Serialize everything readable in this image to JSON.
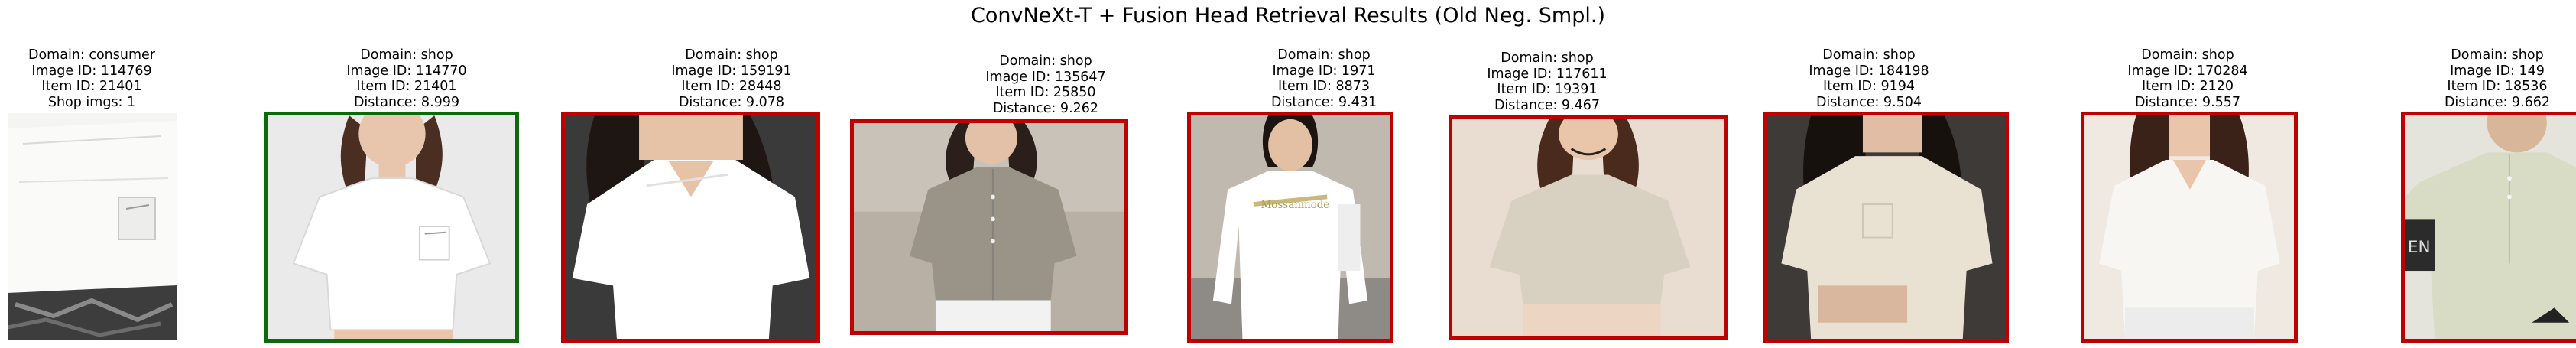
{
  "title": "ConvNeXt-T + Fusion Head Retrieval Results (Old Neg. Smpl.)",
  "colors": {
    "correct_border": "#0b6b0b",
    "incorrect_border": "#c00000"
  },
  "query": {
    "domain": "Domain: consumer",
    "image_id": "Image ID: 114769",
    "item_id": "Item ID: 21401",
    "shop_imgs": "Shop imgs: 1"
  },
  "results": [
    {
      "domain": "Domain: shop",
      "image_id": "Image ID: 114770",
      "item_id": "Item ID: 21401",
      "distance": "Distance: 8.999",
      "match": true
    },
    {
      "domain": "Domain: shop",
      "image_id": "Image ID: 159191",
      "item_id": "Item ID: 28448",
      "distance": "Distance: 9.078",
      "match": false
    },
    {
      "domain": "Domain: shop",
      "image_id": "Image ID: 135647",
      "item_id": "Item ID: 25850",
      "distance": "Distance: 9.262",
      "match": false
    },
    {
      "domain": "Domain: shop",
      "image_id": "Image ID: 1971",
      "item_id": "Item ID: 8873",
      "distance": "Distance: 9.431",
      "match": false
    },
    {
      "domain": "Domain: shop",
      "image_id": "Image ID: 117611",
      "item_id": "Item ID: 19391",
      "distance": "Distance: 9.467",
      "match": false
    },
    {
      "domain": "Domain: shop",
      "image_id": "Image ID: 184198",
      "item_id": "Item ID: 9194",
      "distance": "Distance: 9.504",
      "match": false
    },
    {
      "domain": "Domain: shop",
      "image_id": "Image ID: 170284",
      "item_id": "Item ID: 2120",
      "distance": "Distance: 9.557",
      "match": false
    },
    {
      "domain": "Domain: shop",
      "image_id": "Image ID: 149",
      "item_id": "Item ID: 18536",
      "distance": "Distance: 9.662",
      "match": false
    }
  ]
}
